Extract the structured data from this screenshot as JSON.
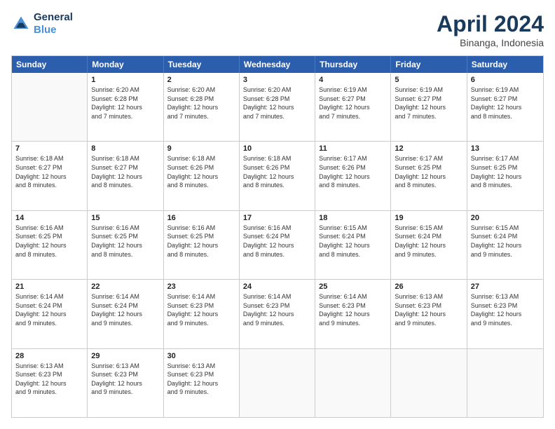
{
  "logo": {
    "line1": "General",
    "line2": "Blue"
  },
  "title": "April 2024",
  "subtitle": "Binanga, Indonesia",
  "header_days": [
    "Sunday",
    "Monday",
    "Tuesday",
    "Wednesday",
    "Thursday",
    "Friday",
    "Saturday"
  ],
  "weeks": [
    [
      {
        "day": "",
        "info": ""
      },
      {
        "day": "1",
        "info": "Sunrise: 6:20 AM\nSunset: 6:28 PM\nDaylight: 12 hours\nand 7 minutes."
      },
      {
        "day": "2",
        "info": "Sunrise: 6:20 AM\nSunset: 6:28 PM\nDaylight: 12 hours\nand 7 minutes."
      },
      {
        "day": "3",
        "info": "Sunrise: 6:20 AM\nSunset: 6:28 PM\nDaylight: 12 hours\nand 7 minutes."
      },
      {
        "day": "4",
        "info": "Sunrise: 6:19 AM\nSunset: 6:27 PM\nDaylight: 12 hours\nand 7 minutes."
      },
      {
        "day": "5",
        "info": "Sunrise: 6:19 AM\nSunset: 6:27 PM\nDaylight: 12 hours\nand 7 minutes."
      },
      {
        "day": "6",
        "info": "Sunrise: 6:19 AM\nSunset: 6:27 PM\nDaylight: 12 hours\nand 8 minutes."
      }
    ],
    [
      {
        "day": "7",
        "info": "Sunrise: 6:18 AM\nSunset: 6:27 PM\nDaylight: 12 hours\nand 8 minutes."
      },
      {
        "day": "8",
        "info": "Sunrise: 6:18 AM\nSunset: 6:27 PM\nDaylight: 12 hours\nand 8 minutes."
      },
      {
        "day": "9",
        "info": "Sunrise: 6:18 AM\nSunset: 6:26 PM\nDaylight: 12 hours\nand 8 minutes."
      },
      {
        "day": "10",
        "info": "Sunrise: 6:18 AM\nSunset: 6:26 PM\nDaylight: 12 hours\nand 8 minutes."
      },
      {
        "day": "11",
        "info": "Sunrise: 6:17 AM\nSunset: 6:26 PM\nDaylight: 12 hours\nand 8 minutes."
      },
      {
        "day": "12",
        "info": "Sunrise: 6:17 AM\nSunset: 6:25 PM\nDaylight: 12 hours\nand 8 minutes."
      },
      {
        "day": "13",
        "info": "Sunrise: 6:17 AM\nSunset: 6:25 PM\nDaylight: 12 hours\nand 8 minutes."
      }
    ],
    [
      {
        "day": "14",
        "info": "Sunrise: 6:16 AM\nSunset: 6:25 PM\nDaylight: 12 hours\nand 8 minutes."
      },
      {
        "day": "15",
        "info": "Sunrise: 6:16 AM\nSunset: 6:25 PM\nDaylight: 12 hours\nand 8 minutes."
      },
      {
        "day": "16",
        "info": "Sunrise: 6:16 AM\nSunset: 6:25 PM\nDaylight: 12 hours\nand 8 minutes."
      },
      {
        "day": "17",
        "info": "Sunrise: 6:16 AM\nSunset: 6:24 PM\nDaylight: 12 hours\nand 8 minutes."
      },
      {
        "day": "18",
        "info": "Sunrise: 6:15 AM\nSunset: 6:24 PM\nDaylight: 12 hours\nand 8 minutes."
      },
      {
        "day": "19",
        "info": "Sunrise: 6:15 AM\nSunset: 6:24 PM\nDaylight: 12 hours\nand 9 minutes."
      },
      {
        "day": "20",
        "info": "Sunrise: 6:15 AM\nSunset: 6:24 PM\nDaylight: 12 hours\nand 9 minutes."
      }
    ],
    [
      {
        "day": "21",
        "info": "Sunrise: 6:14 AM\nSunset: 6:24 PM\nDaylight: 12 hours\nand 9 minutes."
      },
      {
        "day": "22",
        "info": "Sunrise: 6:14 AM\nSunset: 6:24 PM\nDaylight: 12 hours\nand 9 minutes."
      },
      {
        "day": "23",
        "info": "Sunrise: 6:14 AM\nSunset: 6:23 PM\nDaylight: 12 hours\nand 9 minutes."
      },
      {
        "day": "24",
        "info": "Sunrise: 6:14 AM\nSunset: 6:23 PM\nDaylight: 12 hours\nand 9 minutes."
      },
      {
        "day": "25",
        "info": "Sunrise: 6:14 AM\nSunset: 6:23 PM\nDaylight: 12 hours\nand 9 minutes."
      },
      {
        "day": "26",
        "info": "Sunrise: 6:13 AM\nSunset: 6:23 PM\nDaylight: 12 hours\nand 9 minutes."
      },
      {
        "day": "27",
        "info": "Sunrise: 6:13 AM\nSunset: 6:23 PM\nDaylight: 12 hours\nand 9 minutes."
      }
    ],
    [
      {
        "day": "28",
        "info": "Sunrise: 6:13 AM\nSunset: 6:23 PM\nDaylight: 12 hours\nand 9 minutes."
      },
      {
        "day": "29",
        "info": "Sunrise: 6:13 AM\nSunset: 6:23 PM\nDaylight: 12 hours\nand 9 minutes."
      },
      {
        "day": "30",
        "info": "Sunrise: 6:13 AM\nSunset: 6:23 PM\nDaylight: 12 hours\nand 9 minutes."
      },
      {
        "day": "",
        "info": ""
      },
      {
        "day": "",
        "info": ""
      },
      {
        "day": "",
        "info": ""
      },
      {
        "day": "",
        "info": ""
      }
    ]
  ]
}
